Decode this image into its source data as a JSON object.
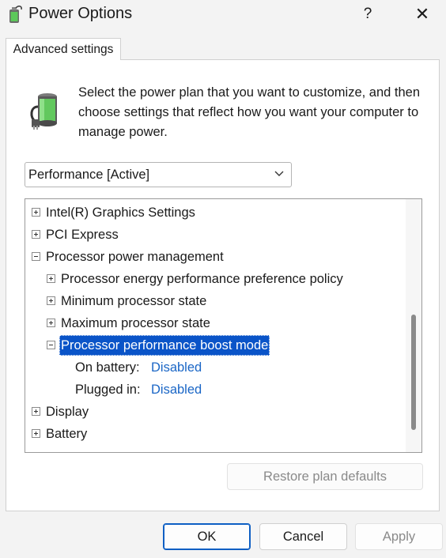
{
  "window": {
    "title": "Power Options",
    "help_label": "?",
    "close_label": "✕"
  },
  "tabs": [
    {
      "label": "Advanced settings",
      "active": true
    }
  ],
  "description": "Select the power plan that you want to customize, and then choose settings that reflect how you want your computer to manage power.",
  "plan_select": {
    "value": "Performance [Active]"
  },
  "tree": {
    "items": [
      {
        "label": "Intel(R) Graphics Settings",
        "expanded": false
      },
      {
        "label": "PCI Express",
        "expanded": false
      },
      {
        "label": "Processor power management",
        "expanded": true
      },
      {
        "label": "Processor energy performance preference policy",
        "expanded": false
      },
      {
        "label": "Minimum processor state",
        "expanded": false
      },
      {
        "label": "Maximum processor state",
        "expanded": false
      },
      {
        "label": "Processor performance boost mode",
        "expanded": true,
        "selected": true
      },
      {
        "label": "On battery:",
        "value": "Disabled"
      },
      {
        "label": "Plugged in:",
        "value": "Disabled"
      },
      {
        "label": "Display",
        "expanded": false
      },
      {
        "label": "Battery",
        "expanded": false
      }
    ]
  },
  "buttons": {
    "restore": "Restore plan defaults",
    "ok": "OK",
    "cancel": "Cancel",
    "apply": "Apply"
  },
  "colors": {
    "selection": "#0a54c8",
    "link": "#1a66c6",
    "accent": "#0e5fc4"
  },
  "icons": {
    "app": "power-plug-battery-icon",
    "plan": "battery-plug-icon",
    "dropdown": "chevron-down-icon"
  }
}
